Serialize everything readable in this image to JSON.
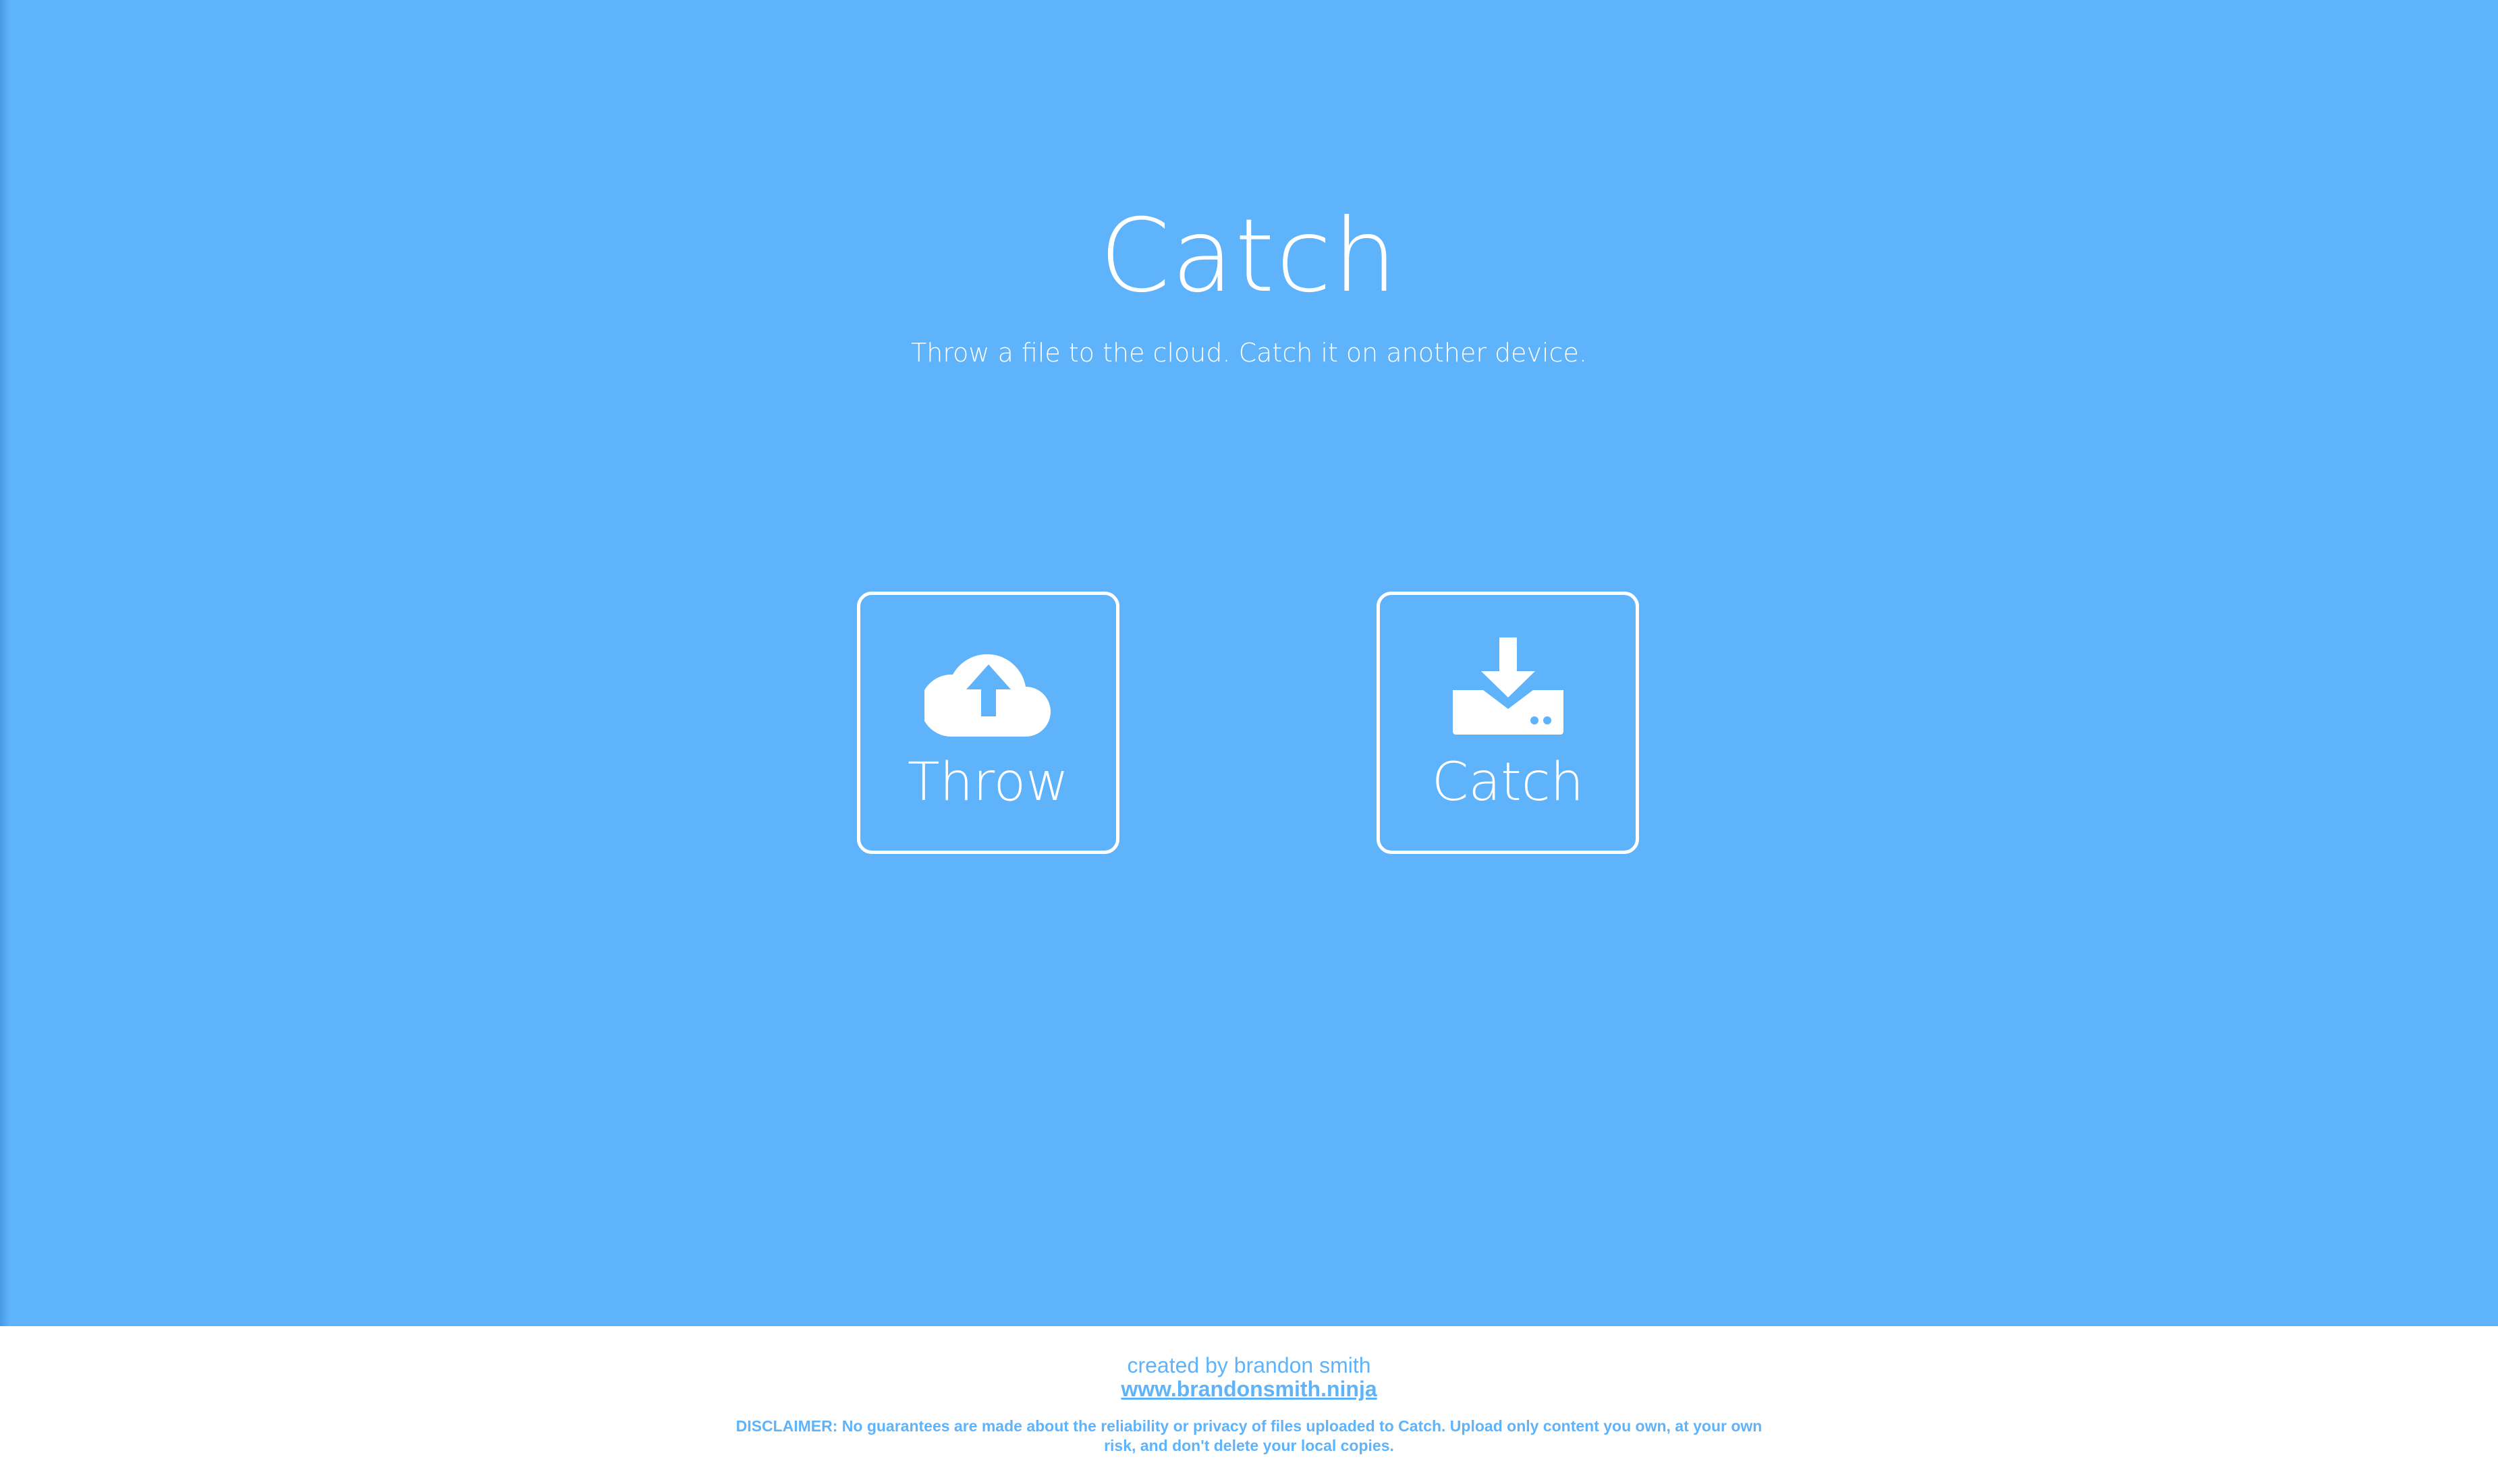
{
  "hero": {
    "title": "Catch",
    "subtitle": "Throw a file to the cloud. Catch it on another device."
  },
  "actions": [
    {
      "label": "Throw",
      "icon": "cloud-upload-icon"
    },
    {
      "label": "Catch",
      "icon": "download-tray-icon"
    }
  ],
  "footer": {
    "credit": "created by brandon smith",
    "link_text": "www.brandonsmith.ninja",
    "disclaimer": "DISCLAIMER: No guarantees are made about the reliability or privacy of files uploaded to Catch. Upload only content you own, at your own risk, and don't delete your local copies."
  },
  "colors": {
    "background": "#5fb3fb",
    "foreground": "#ffffff",
    "footer_background": "#ffffff",
    "footer_text": "#5fb3fb"
  }
}
